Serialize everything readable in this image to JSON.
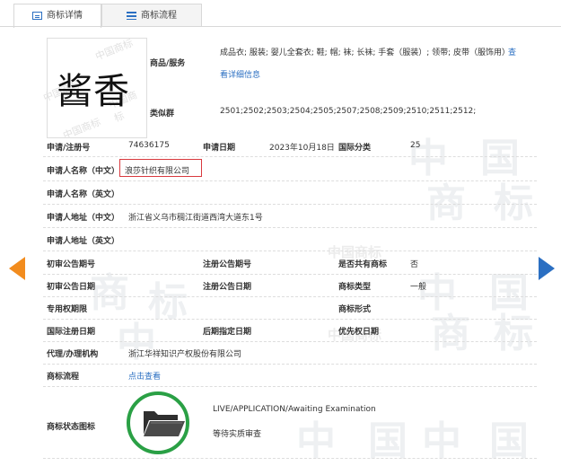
{
  "tabs": [
    {
      "label": "商标详情",
      "icon": "document-icon",
      "active": true
    },
    {
      "label": "商标流程",
      "icon": "list-icon",
      "active": false
    }
  ],
  "watermark": {
    "char1": "中",
    "char2": "国",
    "char3": "商",
    "char4": "标",
    "small": "中国商标"
  },
  "trademark": {
    "logo_text": "酱香"
  },
  "goods": {
    "label": "商品/服务",
    "value": "成品衣; 服装; 婴儿全套衣; 鞋; 帽; 袜; 长袜; 手套（服装）; 领带; 皮带（服饰用）",
    "view_more": "查",
    "details_link": "看详细信息"
  },
  "similar_groups": {
    "label": "类似群",
    "value": "2501;2502;2503;2504;2505;2507;2508;2509;2510;2511;2512;"
  },
  "reg_no": {
    "label": "申请/注册号",
    "value": "74636175"
  },
  "app_date": {
    "label": "申请日期",
    "value": "2023年10月18日"
  },
  "intl_class": {
    "label": "国际分类",
    "value": "25"
  },
  "applicant_cn": {
    "label": "申请人名称（中文）",
    "value": "浪莎针织有限公司"
  },
  "applicant_en": {
    "label": "申请人名称（英文）",
    "value": ""
  },
  "address_cn": {
    "label": "申请人地址（中文）",
    "value": "浙江省义乌市稠江街道西湾大道东1号"
  },
  "address_en": {
    "label": "申请人地址（英文）",
    "value": ""
  },
  "prelim_no": {
    "label": "初审公告期号",
    "value": ""
  },
  "reg_pub_no": {
    "label": "注册公告期号",
    "value": ""
  },
  "shared": {
    "label": "是否共有商标",
    "value": "否"
  },
  "prelim_date": {
    "label": "初审公告日期",
    "value": ""
  },
  "reg_pub_date": {
    "label": "注册公告日期",
    "value": ""
  },
  "tm_type": {
    "label": "商标类型",
    "value": "一般"
  },
  "exclusive_period": {
    "label": "专用权期限",
    "value": ""
  },
  "tm_form": {
    "label": "商标形式",
    "value": ""
  },
  "intl_reg_date": {
    "label": "国际注册日期",
    "value": ""
  },
  "later_date": {
    "label": "后期指定日期",
    "value": ""
  },
  "priority_date": {
    "label": "优先权日期",
    "value": ""
  },
  "agent": {
    "label": "代理/办理机构",
    "value": "浙江华祥知识产权股份有限公司"
  },
  "process": {
    "label": "商标流程",
    "link": "点击查看"
  },
  "status": {
    "label": "商标状态图标",
    "status_en": "LIVE/APPLICATION/Awaiting Examination",
    "status_cn": "等待实质审查"
  },
  "colors": {
    "accent": "#2b6fc2",
    "highlight": "#d9393e",
    "status_green": "#2aa045",
    "arrow_orange": "#f28c1e"
  }
}
